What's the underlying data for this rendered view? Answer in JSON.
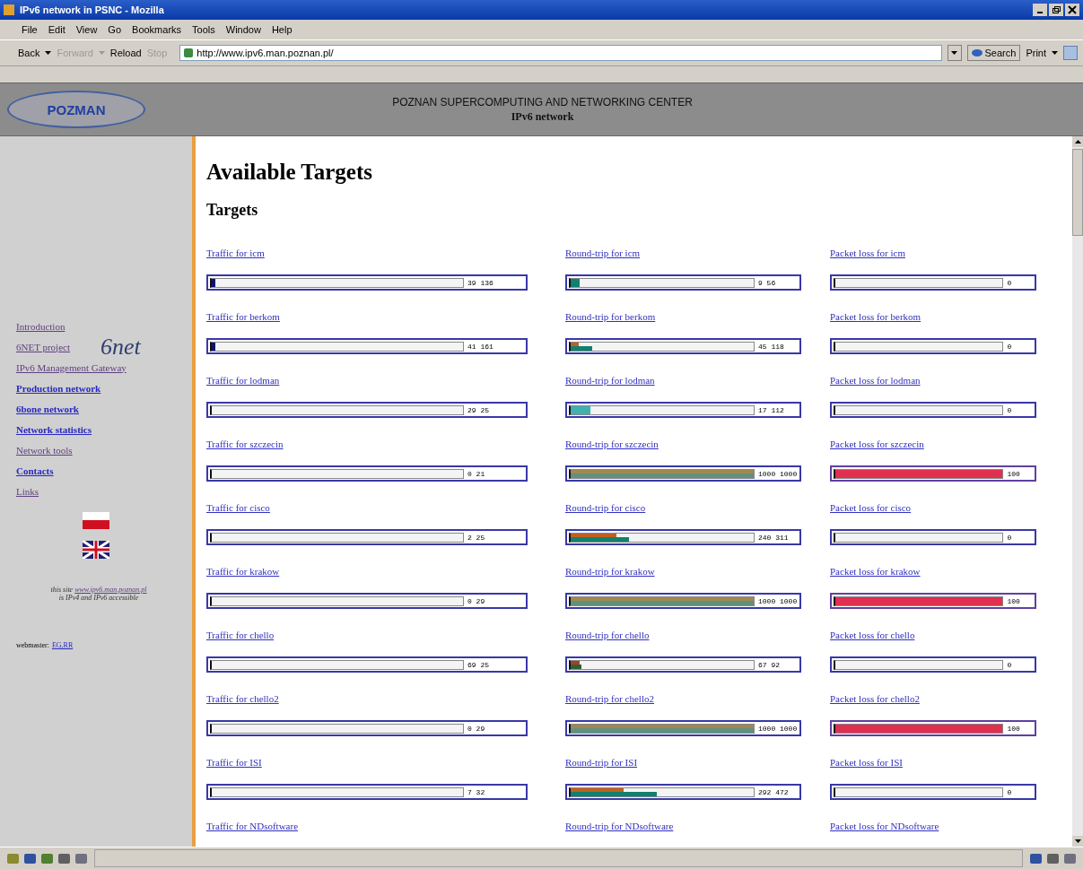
{
  "window": {
    "title": "IPv6 network in PSNC - Mozilla"
  },
  "menu": [
    "File",
    "Edit",
    "View",
    "Go",
    "Bookmarks",
    "Tools",
    "Window",
    "Help"
  ],
  "toolbar": {
    "buttons": [
      {
        "label": "Back",
        "disabled": false,
        "dropdown": true
      },
      {
        "label": "Forward",
        "disabled": true,
        "dropdown": true
      },
      {
        "label": "Reload",
        "disabled": false,
        "dropdown": false
      },
      {
        "label": "Stop",
        "disabled": true,
        "dropdown": false
      }
    ],
    "url": "http://www.ipv6.man.poznan.pl/",
    "search": "Search",
    "print": "Print"
  },
  "header": {
    "logo": "POZMAN",
    "title": "POZNAN SUPERCOMPUTING AND NETWORKING CENTER",
    "subtitle": "IPv6 network"
  },
  "sidebar": {
    "items": [
      {
        "label": "Introduction",
        "visited": true
      },
      {
        "label": "6NET project",
        "visited": true,
        "logo": "6net"
      },
      {
        "label": "IPv6 Management Gateway",
        "visited": true
      },
      {
        "label": "Production network",
        "visited": false
      },
      {
        "label": "6bone network",
        "visited": false
      },
      {
        "label": "Network statistics",
        "visited": false
      },
      {
        "label": "Network tools",
        "visited": true
      },
      {
        "label": "Contacts",
        "visited": false
      },
      {
        "label": "Links",
        "visited": true
      }
    ],
    "note_link": "www.ipv6.man.poznan.pl",
    "note_prefix": "this site",
    "note_suffix": "is IPv4 and IPv6 accessible",
    "webmaster_label": "webmaster:",
    "webmaster_link": "EG,RR"
  },
  "page": {
    "title": "Available Targets",
    "subtitle": "Targets"
  },
  "targets": [
    {
      "cells": [
        {
          "kind": "traffic",
          "label": "Traffic for icm",
          "reading": "39 136",
          "fills": [
            {
              "color": "#101070",
              "level": 0.015
            }
          ]
        },
        {
          "kind": "roundtrip",
          "label": "Round-trip for icm",
          "reading": "9 56",
          "fills": [
            {
              "color": "#108070",
              "level": 0.05
            }
          ]
        },
        {
          "kind": "loss",
          "label": "Packet loss for icm",
          "reading": "0"
        }
      ]
    },
    {
      "cells": [
        {
          "kind": "traffic",
          "label": "Traffic for berkom",
          "reading": "41 161",
          "fills": [
            {
              "color": "#101070",
              "level": 0.015
            }
          ]
        },
        {
          "kind": "roundtrip",
          "label": "Round-trip for berkom",
          "reading": "45 118",
          "fills": [
            {
              "color": "#c06020",
              "level": 0.045
            },
            {
              "color": "#108070",
              "level": 0.12
            }
          ]
        },
        {
          "kind": "loss",
          "label": "Packet loss for berkom",
          "reading": "0"
        }
      ]
    },
    {
      "cells": [
        {
          "kind": "traffic",
          "label": "Traffic for lodman",
          "reading": "29 25"
        },
        {
          "kind": "roundtrip",
          "label": "Round-trip for lodman",
          "reading": "17 112",
          "fills": [
            {
              "color": "#40b0b0",
              "level": 0.11
            }
          ]
        },
        {
          "kind": "loss",
          "label": "Packet loss for lodman",
          "reading": "0"
        }
      ]
    },
    {
      "cells": [
        {
          "kind": "traffic",
          "label": "Traffic for szczecin",
          "reading": "0 21"
        },
        {
          "kind": "roundtrip",
          "label": "Round-trip for szczecin",
          "reading": "1000 1000",
          "fills": [
            {
              "color": "#a08850",
              "level": 1
            },
            {
              "color": "#609080",
              "level": 1
            }
          ]
        },
        {
          "kind": "loss",
          "label": "Packet loss for szczecin",
          "reading": "100",
          "fills": [
            {
              "color": "#e03050",
              "level": 1
            }
          ]
        }
      ]
    },
    {
      "cells": [
        {
          "kind": "traffic",
          "label": "Traffic for cisco",
          "reading": "2 25"
        },
        {
          "kind": "roundtrip",
          "label": "Round-trip for cisco",
          "reading": "240 311",
          "fills": [
            {
              "color": "#c06020",
              "level": 0.25
            },
            {
              "color": "#108070",
              "level": 0.32
            }
          ]
        },
        {
          "kind": "loss",
          "label": "Packet loss for cisco",
          "reading": "0"
        }
      ]
    },
    {
      "cells": [
        {
          "kind": "traffic",
          "label": "Traffic for krakow",
          "reading": "0 29"
        },
        {
          "kind": "roundtrip",
          "label": "Round-trip for krakow",
          "reading": "1000 1000",
          "fills": [
            {
              "color": "#a08850",
              "level": 1
            },
            {
              "color": "#609080",
              "level": 1
            }
          ]
        },
        {
          "kind": "loss",
          "label": "Packet loss for krakow",
          "reading": "100",
          "fills": [
            {
              "color": "#e03050",
              "level": 1
            }
          ]
        }
      ]
    },
    {
      "cells": [
        {
          "kind": "traffic",
          "label": "Traffic for chello",
          "reading": "69 25"
        },
        {
          "kind": "roundtrip",
          "label": "Round-trip for chello",
          "reading": "67 92",
          "fills": [
            {
              "color": "#a04030",
              "level": 0.05
            },
            {
              "color": "#306030",
              "level": 0.06
            }
          ]
        },
        {
          "kind": "loss",
          "label": "Packet loss for chello",
          "reading": "0"
        }
      ]
    },
    {
      "cells": [
        {
          "kind": "traffic",
          "label": "Traffic for chello2",
          "reading": "0 29"
        },
        {
          "kind": "roundtrip",
          "label": "Round-trip for chello2",
          "reading": "1000 1000",
          "fills": [
            {
              "color": "#a08850",
              "level": 1
            },
            {
              "color": "#609080",
              "level": 1
            }
          ]
        },
        {
          "kind": "loss",
          "label": "Packet loss for chello2",
          "reading": "100",
          "fills": [
            {
              "color": "#e03050",
              "level": 1
            }
          ]
        }
      ]
    },
    {
      "cells": [
        {
          "kind": "traffic",
          "label": "Traffic for ISI",
          "reading": "7 32"
        },
        {
          "kind": "roundtrip",
          "label": "Round-trip for ISI",
          "reading": "292 472",
          "fills": [
            {
              "color": "#c06020",
              "level": 0.29
            },
            {
              "color": "#108070",
              "level": 0.47
            }
          ]
        },
        {
          "kind": "loss",
          "label": "Packet loss for ISI",
          "reading": "0"
        }
      ]
    },
    {
      "cells": [
        {
          "kind": "traffic",
          "label": "Traffic for NDsoftware"
        },
        {
          "kind": "roundtrip",
          "label": "Round-trip for NDsoftware"
        },
        {
          "kind": "loss",
          "label": "Packet loss for NDsoftware"
        }
      ]
    }
  ]
}
